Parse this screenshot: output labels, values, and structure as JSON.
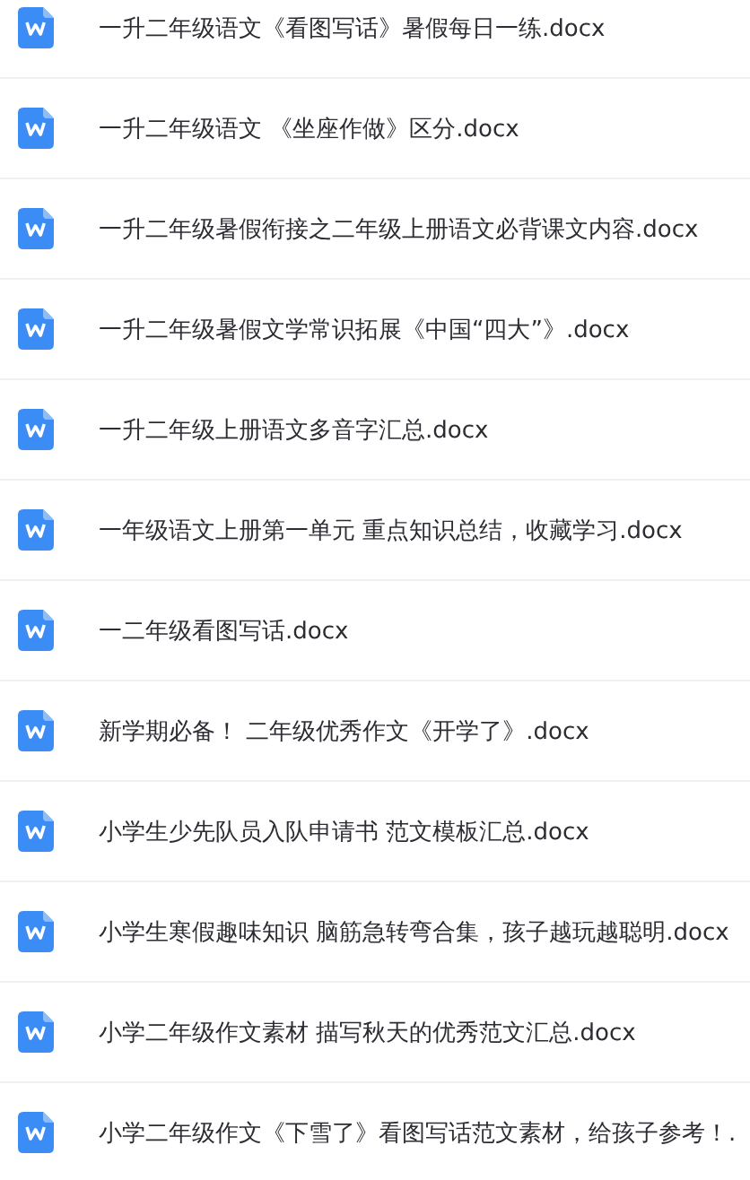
{
  "files": [
    {
      "name": "一升二年级语文《看图写话》暑假每日一练.docx"
    },
    {
      "name": "一升二年级语文 《坐座作做》区分.docx"
    },
    {
      "name": "一升二年级暑假衔接之二年级上册语文必背课文内容.docx"
    },
    {
      "name": "一升二年级暑假文学常识拓展《中国“四大”》.docx"
    },
    {
      "name": "一升二年级上册语文多音字汇总.docx"
    },
    {
      "name": "一年级语文上册第一单元 重点知识总结，收藏学习.docx"
    },
    {
      "name": "一二年级看图写话.docx"
    },
    {
      "name": "新学期必备！ 二年级优秀作文《开学了》.docx"
    },
    {
      "name": "小学生少先队员入队申请书 范文模板汇总.docx"
    },
    {
      "name": "小学生寒假趣味知识 脑筋急转弯合集，孩子越玩越聪明.docx"
    },
    {
      "name": "小学二年级作文素材 描写秋天的优秀范文汇总.docx"
    },
    {
      "name": "小学二年级作文《下雪了》看图写话范文素材，给孩子参考！."
    }
  ]
}
